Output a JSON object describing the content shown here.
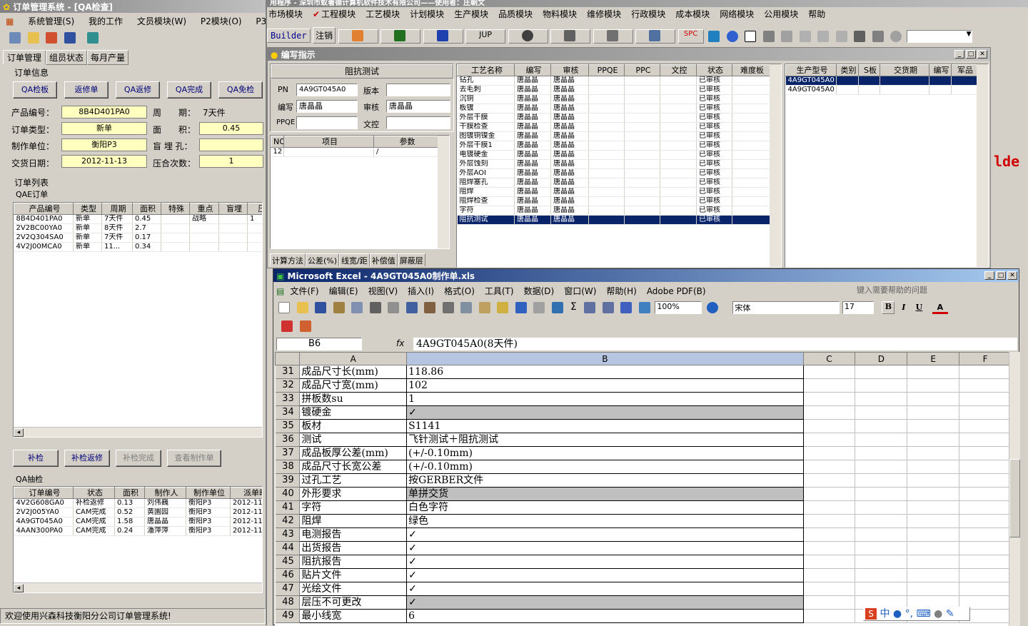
{
  "left_window": {
    "title": "订单管理系统 - [QA检查]",
    "menu": [
      "系统管理(S)",
      "我的工作",
      "文员模块(W)",
      "P2模块(O)",
      "P3模"
    ],
    "tabs": [
      "订单管理",
      "组员状态",
      "每月产量"
    ],
    "section_order_info": "订单信息",
    "buttons_top": [
      "QA检板",
      "返修单",
      "QA返修",
      "QA完成",
      "QA免检"
    ],
    "fields": {
      "product_no_label": "产品编号：",
      "product_no": "8B4D401PA0",
      "period_label": "周　　期：",
      "period": "7天件",
      "order_type_label": "订单类型：",
      "order_type": "新单",
      "area_label": "面　　积：",
      "area": "0.45",
      "unit_label": "制作单位：",
      "unit": "衡阳P3",
      "blind_label": "盲 埋 孔：",
      "blind": "",
      "date_label": "交货日期：",
      "date": "2012-11-13",
      "press_label": "压合次数：",
      "press": "1"
    },
    "order_list_label": "订单列表",
    "qae_label": "QAE订单",
    "qae_headers": [
      "产品编号",
      "类型",
      "周期",
      "面积",
      "特殊",
      "重点",
      "盲埋",
      "压"
    ],
    "qae_rows": [
      [
        "8B4D401PA0",
        "新单",
        "7天件",
        "0.45",
        "",
        "战略",
        "",
        "1"
      ],
      [
        "2V2BC00YA0",
        "新单",
        "8天件",
        "2.7",
        "",
        "",
        "",
        ""
      ],
      [
        "2V2Q304SA0",
        "新单",
        "7天件",
        "0.17",
        "",
        "",
        "",
        ""
      ],
      [
        "4V2J00MCA0",
        "新单",
        "11...",
        "0.34",
        "",
        "",
        "",
        ""
      ]
    ],
    "buttons_mid": [
      "补检",
      "补检返修",
      "补检完成",
      "查看制作单"
    ],
    "qa_sample_label": "QA抽检",
    "qa_headers": [
      "订单编号",
      "状态",
      "面积",
      "制作人",
      "制作单位",
      "派单时"
    ],
    "qa_rows": [
      [
        "4V2G608GA0",
        "补检返修",
        "0.13",
        "刘伟巍",
        "衡阳P3",
        "2012-11-1"
      ],
      [
        "2V2J005YA0",
        "CAM完成",
        "0.52",
        "黄園园",
        "衡阳P3",
        "2012-11-3"
      ],
      [
        "4A9GT045A0",
        "CAM完成",
        "1.58",
        "唐晶晶",
        "衡阳P3",
        "2012-11-6"
      ],
      [
        "4AAN300PA0",
        "CAM完成",
        "0.24",
        "潘萍萍",
        "衡阳P3",
        "2012-11-3"
      ]
    ],
    "status": "欢迎使用兴森科技衡阳分公司订单管理系统!"
  },
  "right_window": {
    "title": "用程序 - 深圳市蚁着德计算机软件技术有限公司——使用者：庄朝文",
    "menu": [
      "市场模块",
      "工程模块",
      "工艺模块",
      "计划模块",
      "生产模块",
      "品质模块",
      "物料模块",
      "维修模块",
      "行政模块",
      "成本模块",
      "网络模块",
      "公用模块",
      "帮助"
    ],
    "toolbar_builder": "Builder",
    "toolbar_logout": "注销",
    "toolbar_jup": "JUP",
    "toolbar_spc": "SPC",
    "side_text": "lde"
  },
  "compile_window": {
    "title": "编写指示",
    "panel_title": "阻抗测试",
    "pn_label": "PN",
    "pn": "4A9GT045A0",
    "version_label": "版本",
    "version": "",
    "author_label": "编写",
    "author": "唐晶晶",
    "review_label": "审核",
    "review": "唐晶晶",
    "ppqe_label": "PPQE",
    "ppqe": "",
    "doc_label": "文控",
    "doc": "",
    "param_headers": [
      "NO",
      "项目",
      "参数"
    ],
    "param_rows": [
      [
        "12 /",
        "",
        "/"
      ]
    ],
    "bottom_tabs": [
      "计算方法",
      "公差(%)",
      "线宽/距",
      "补偿值",
      "屏蔽层"
    ],
    "process_headers": [
      "工艺名称",
      "编写",
      "审核",
      "PPQE",
      "PPC",
      "文控",
      "状态",
      "难度板"
    ],
    "process_rows": [
      [
        "钻孔",
        "唐晶晶",
        "唐晶晶",
        "",
        "",
        "",
        "已审核",
        ""
      ],
      [
        "去毛刺",
        "唐晶晶",
        "唐晶晶",
        "",
        "",
        "",
        "已审核",
        ""
      ],
      [
        "沉铜",
        "唐晶晶",
        "唐晶晶",
        "",
        "",
        "",
        "已审核",
        ""
      ],
      [
        "板镀",
        "唐晶晶",
        "唐晶晶",
        "",
        "",
        "",
        "已审核",
        ""
      ],
      [
        "外层干膜",
        "唐晶晶",
        "唐晶晶",
        "",
        "",
        "",
        "已审核",
        ""
      ],
      [
        "干膜检查",
        "唐晶晶",
        "唐晶晶",
        "",
        "",
        "",
        "已审核",
        ""
      ],
      [
        "图镀铜镍金",
        "唐晶晶",
        "唐晶晶",
        "",
        "",
        "",
        "已审核",
        ""
      ],
      [
        "外层干膜1",
        "唐晶晶",
        "唐晶晶",
        "",
        "",
        "",
        "已审核",
        ""
      ],
      [
        "电镀硬金",
        "唐晶晶",
        "唐晶晶",
        "",
        "",
        "",
        "已审核",
        ""
      ],
      [
        "外层蚀刻",
        "唐晶晶",
        "唐晶晶",
        "",
        "",
        "",
        "已审核",
        ""
      ],
      [
        "外层AOI",
        "唐晶晶",
        "唐晶晶",
        "",
        "",
        "",
        "已审核",
        ""
      ],
      [
        "阻焊塞孔",
        "唐晶晶",
        "唐晶晶",
        "",
        "",
        "",
        "已审核",
        ""
      ],
      [
        "阻焊",
        "唐晶晶",
        "唐晶晶",
        "",
        "",
        "",
        "已审核",
        ""
      ],
      [
        "阻焊检查",
        "唐晶晶",
        "唐晶晶",
        "",
        "",
        "",
        "已审核",
        ""
      ],
      [
        "字符",
        "唐晶晶",
        "唐晶晶",
        "",
        "",
        "",
        "已审核",
        ""
      ],
      [
        "阻抗测试",
        "唐晶晶",
        "唐晶晶",
        "",
        "",
        "",
        "已审核",
        ""
      ]
    ],
    "model_headers": [
      "生产型号",
      "类别",
      "S板",
      "交货期",
      "编写",
      "军品"
    ],
    "model_rows": [
      [
        "4A9GT045A0",
        "",
        "",
        "",
        "",
        ""
      ],
      [
        "4A9GT045A0",
        "",
        "",
        "",
        "",
        ""
      ]
    ]
  },
  "excel": {
    "title": "Microsoft Excel - 4A9GT045A0制作单.xls",
    "menu": [
      "文件(F)",
      "编辑(E)",
      "视图(V)",
      "插入(I)",
      "格式(O)",
      "工具(T)",
      "数据(D)",
      "窗口(W)",
      "帮助(H)",
      "Adobe PDF(B)"
    ],
    "help_placeholder": "键入需要帮助的问题",
    "zoom": "100%",
    "font": "宋体",
    "font_size": "17",
    "name_box": "B6",
    "formula": "4A9GT045A0(8天件)",
    "col_headers": [
      "A",
      "B",
      "C",
      "D",
      "E",
      "F"
    ],
    "rows": [
      {
        "n": "31",
        "a": "成品尺寸长(mm)",
        "b": "118.86",
        "gray": false
      },
      {
        "n": "32",
        "a": "成品尺寸宽(mm)",
        "b": "102",
        "gray": false
      },
      {
        "n": "33",
        "a": "拼板数su",
        "b": "1",
        "gray": false
      },
      {
        "n": "34",
        "a": "镀硬金",
        "b": "✓",
        "gray": true
      },
      {
        "n": "35",
        "a": "板材",
        "b": "S1141",
        "gray": false
      },
      {
        "n": "36",
        "a": "测试",
        "b": "飞针测试＋阻抗测试",
        "gray": false
      },
      {
        "n": "37",
        "a": "成品板厚公差(mm)",
        "b": "(+/-0.10mm)",
        "gray": false
      },
      {
        "n": "38",
        "a": "成品尺寸长宽公差",
        "b": "(+/-0.10mm)",
        "gray": false
      },
      {
        "n": "39",
        "a": "过孔工艺",
        "b": "按GERBER文件",
        "gray": false
      },
      {
        "n": "40",
        "a": "外形要求",
        "b": "单拼交货",
        "gray": true
      },
      {
        "n": "41",
        "a": "字符",
        "b": "白色字符",
        "gray": false
      },
      {
        "n": "42",
        "a": "阻焊",
        "b": "绿色",
        "gray": false
      },
      {
        "n": "43",
        "a": "电测报告",
        "b": "✓",
        "gray": false
      },
      {
        "n": "44",
        "a": "出货报告",
        "b": "✓",
        "gray": false
      },
      {
        "n": "45",
        "a": "阻抗报告",
        "b": "✓",
        "gray": false
      },
      {
        "n": "46",
        "a": "贴片文件",
        "b": "✓",
        "gray": false
      },
      {
        "n": "47",
        "a": "光绘文件",
        "b": "✓",
        "gray": false
      },
      {
        "n": "48",
        "a": "层压不可更改",
        "b": "✓",
        "gray": true
      },
      {
        "n": "49",
        "a": "最小线宽",
        "b": "6",
        "gray": false
      }
    ],
    "ime": "中"
  }
}
